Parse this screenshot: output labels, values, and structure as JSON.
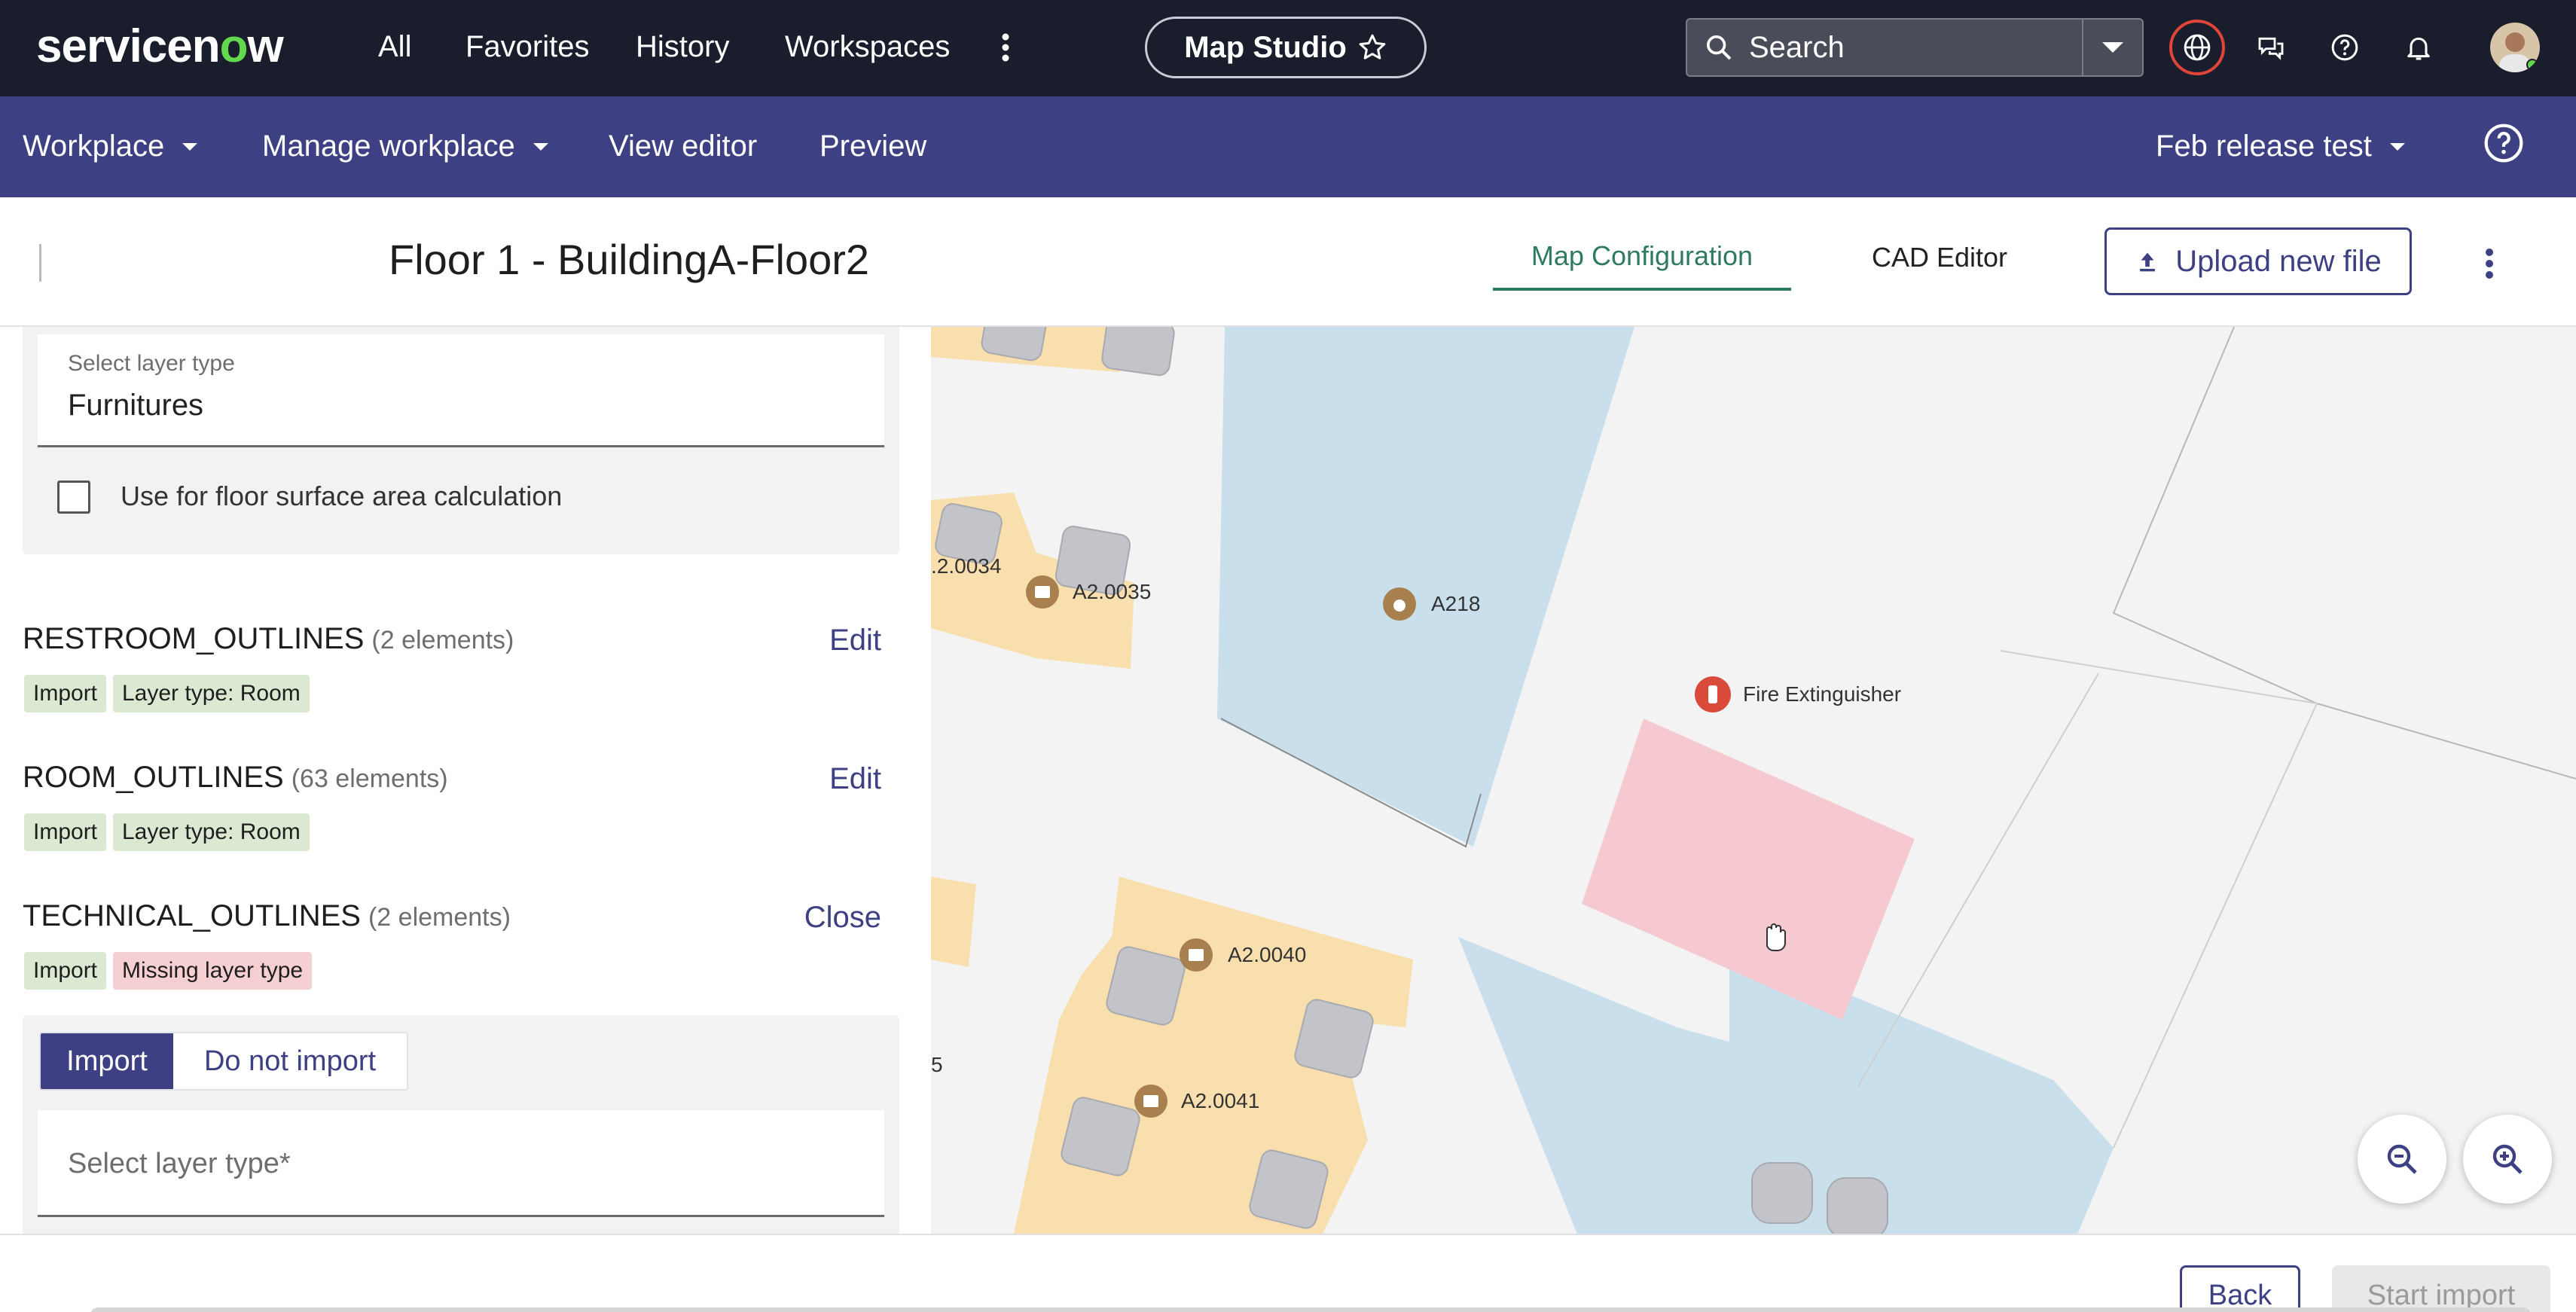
{
  "topbar": {
    "logo_text": "servicenow",
    "nav": [
      "All",
      "Favorites",
      "History",
      "Workspaces"
    ],
    "app_pill": "Map Studio",
    "search_placeholder": "Search"
  },
  "subnav": {
    "workplace": "Workplace",
    "manage": "Manage workplace",
    "view_editor": "View editor",
    "preview": "Preview",
    "release": "Feb release test"
  },
  "header": {
    "title": "Floor 1 - BuildingA-Floor2",
    "tab_map_config": "Map Configuration",
    "tab_cad": "CAD Editor",
    "upload": "Upload new file"
  },
  "panel": {
    "layer_type_label": "Select layer type",
    "layer_type_value": "Furnitures",
    "checkbox_label": "Use for floor surface area calculation",
    "sections": [
      {
        "name": "RESTROOM_OUTLINES",
        "count": "(2 elements)",
        "action": "Edit",
        "tags": [
          "Import",
          "Layer type: Room"
        ]
      },
      {
        "name": "ROOM_OUTLINES",
        "count": "(63 elements)",
        "action": "Edit",
        "tags": [
          "Import",
          "Layer type: Room"
        ]
      },
      {
        "name": "TECHNICAL_OUTLINES",
        "count": "(2 elements)",
        "action": "Close",
        "tags": [
          "Import",
          "Missing layer type"
        ]
      }
    ],
    "toggle_import": "Import",
    "toggle_no_import": "Do not import",
    "select_placeholder": "Select layer type*"
  },
  "map": {
    "labels": {
      "a20034": ".2.0034",
      "a20035": "A2.0035",
      "a218": "A218",
      "fire": "Fire Extinguisher",
      "a20040": "A2.0040",
      "a20041": "A2.0041",
      "edge5": "5"
    }
  },
  "footer": {
    "back": "Back",
    "start": "Start import"
  },
  "colors": {
    "topbar": "#1a1d2b",
    "subnav": "#3d4183",
    "accent_green": "#2e7a63",
    "room_blue": "#c9dfec",
    "room_yellow": "#f9dfad",
    "room_pink": "#f5c9cf"
  }
}
